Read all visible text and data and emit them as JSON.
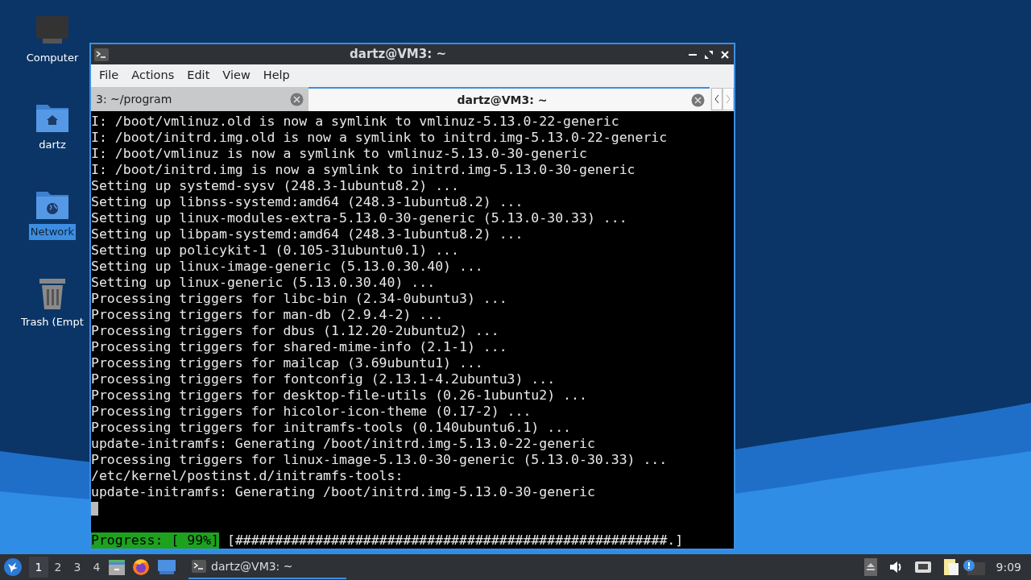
{
  "desktop_icons": [
    {
      "kind": "computer",
      "label": "Computer",
      "selected": false
    },
    {
      "kind": "home",
      "label": "dartz",
      "selected": false
    },
    {
      "kind": "network",
      "label": "Network",
      "selected": true
    },
    {
      "kind": "trash",
      "label": "Trash (Empt",
      "selected": false
    }
  ],
  "window": {
    "title": "dartz@VM3: ~",
    "menu": [
      "File",
      "Actions",
      "Edit",
      "View",
      "Help"
    ],
    "tabs": [
      {
        "label": "3: ~/program",
        "selected": false
      },
      {
        "label": "dartz@VM3: ~",
        "selected": true
      }
    ],
    "lines": [
      "I: /boot/vmlinuz.old is now a symlink to vmlinuz-5.13.0-22-generic",
      "I: /boot/initrd.img.old is now a symlink to initrd.img-5.13.0-22-generic",
      "I: /boot/vmlinuz is now a symlink to vmlinuz-5.13.0-30-generic",
      "I: /boot/initrd.img is now a symlink to initrd.img-5.13.0-30-generic",
      "Setting up systemd-sysv (248.3-1ubuntu8.2) ...",
      "Setting up libnss-systemd:amd64 (248.3-1ubuntu8.2) ...",
      "Setting up linux-modules-extra-5.13.0-30-generic (5.13.0-30.33) ...",
      "Setting up libpam-systemd:amd64 (248.3-1ubuntu8.2) ...",
      "Setting up policykit-1 (0.105-31ubuntu0.1) ...",
      "Setting up linux-image-generic (5.13.0.30.40) ...",
      "Setting up linux-generic (5.13.0.30.40) ...",
      "Processing triggers for libc-bin (2.34-0ubuntu3) ...",
      "Processing triggers for man-db (2.9.4-2) ...",
      "Processing triggers for dbus (1.12.20-2ubuntu2) ...",
      "Processing triggers for shared-mime-info (2.1-1) ...",
      "Processing triggers for mailcap (3.69ubuntu1) ...",
      "Processing triggers for fontconfig (2.13.1-4.2ubuntu3) ...",
      "Processing triggers for desktop-file-utils (0.26-1ubuntu2) ...",
      "Processing triggers for hicolor-icon-theme (0.17-2) ...",
      "Processing triggers for initramfs-tools (0.140ubuntu6.1) ...",
      "update-initramfs: Generating /boot/initrd.img-5.13.0-22-generic",
      "Processing triggers for linux-image-5.13.0-30-generic (5.13.0-30.33) ...",
      "/etc/kernel/postinst.d/initramfs-tools:",
      "update-initramfs: Generating /boot/initrd.img-5.13.0-30-generic"
    ],
    "progress": {
      "label": "Progress: [ 99%]",
      "bar": "[######################################################.]"
    }
  },
  "taskbar": {
    "workspaces": [
      {
        "label": "1",
        "selected": true
      },
      {
        "label": "2",
        "selected": false
      },
      {
        "label": "3",
        "selected": false
      },
      {
        "label": "4",
        "selected": false
      }
    ],
    "tasks": [
      {
        "label": "dartz@VM3: ~",
        "selected": true
      }
    ],
    "clock": "9:09"
  }
}
